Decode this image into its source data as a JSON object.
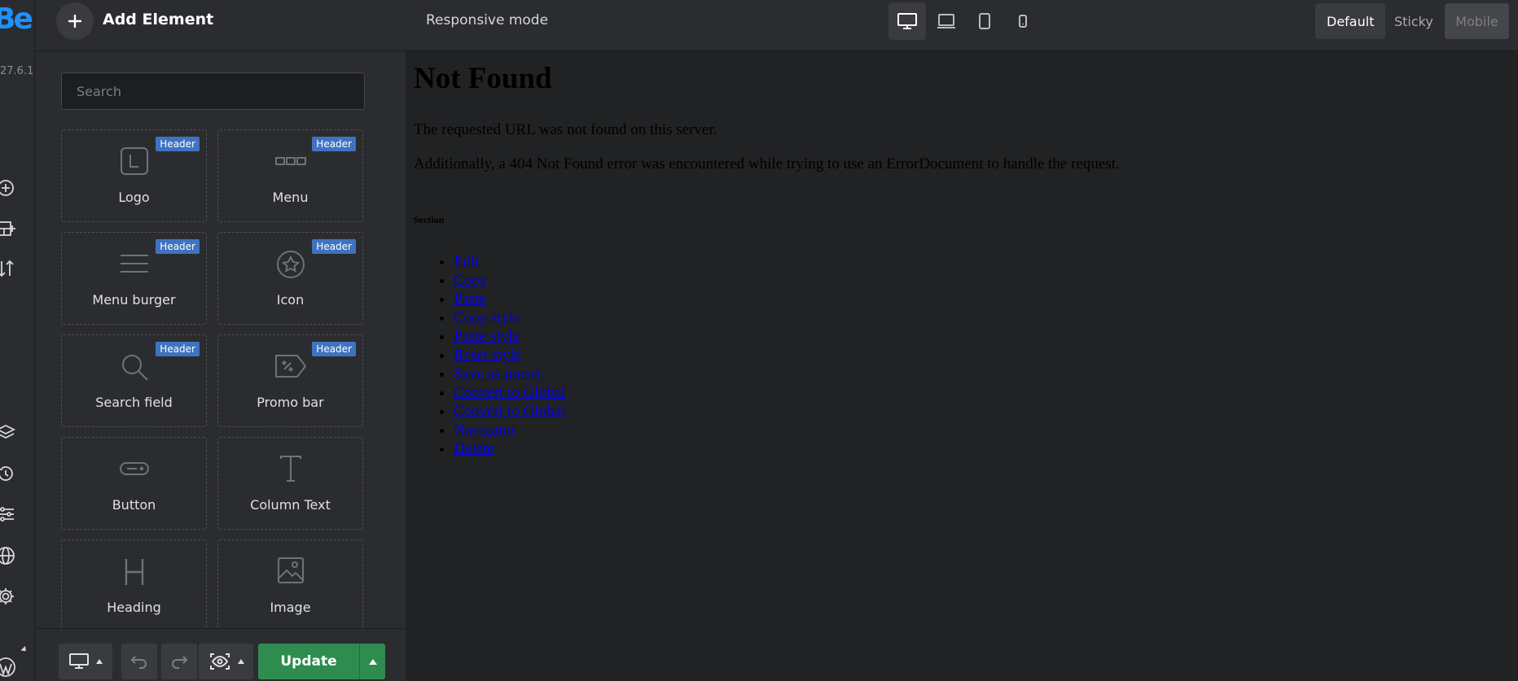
{
  "app": {
    "logo": "Be",
    "version": "27.6.1"
  },
  "rail": {
    "icons": [
      "add-circle-icon",
      "add-section-icon",
      "sort-icon",
      "layers-icon",
      "history-icon",
      "settings-sliders-icon",
      "globe-icon",
      "gear-icon",
      "wordpress-icon"
    ]
  },
  "topbar": {
    "add_title": "Add Element",
    "responsive_mode": "Responsive mode",
    "devices": [
      "desktop",
      "laptop",
      "tablet",
      "mobile"
    ],
    "active_device": "desktop",
    "modes": [
      "Default",
      "Sticky",
      "Mobile"
    ],
    "active_mode": "Default"
  },
  "sidebar": {
    "search_placeholder": "Search",
    "elements": [
      {
        "label": "Logo",
        "badge": "Header",
        "icon": "logo-icon"
      },
      {
        "label": "Menu",
        "badge": "Header",
        "icon": "menu-icon"
      },
      {
        "label": "Menu burger",
        "badge": "Header",
        "icon": "menu-burger-icon"
      },
      {
        "label": "Icon",
        "badge": "Header",
        "icon": "star-icon"
      },
      {
        "label": "Search field",
        "badge": "Header",
        "icon": "search-icon"
      },
      {
        "label": "Promo bar",
        "badge": "Header",
        "icon": "promo-tag-icon"
      },
      {
        "label": "Button",
        "badge": "",
        "icon": "button-icon"
      },
      {
        "label": "Column Text",
        "badge": "",
        "icon": "text-icon"
      },
      {
        "label": "Heading",
        "badge": "",
        "icon": "heading-icon"
      },
      {
        "label": "Image",
        "badge": "",
        "icon": "image-icon"
      }
    ]
  },
  "bottombar": {
    "update_label": "Update"
  },
  "canvas": {
    "title": "Not Found",
    "p1": "The requested URL was not found on this server.",
    "p2": "Additionally, a 404 Not Found error was encountered while trying to use an ErrorDocument to handle the request.",
    "section": "Section",
    "links": [
      "Edit",
      "Copy",
      "Paste",
      "Copy style",
      "Paste style",
      "Reset style",
      "Save as preset",
      "Convert to Global",
      "Convert to Global",
      "Navigator",
      "Delete"
    ]
  },
  "colors": {
    "accent": "#1e90ff",
    "update": "#2e8c4f",
    "badge": "#3f73c2",
    "link": "#0000ee"
  }
}
